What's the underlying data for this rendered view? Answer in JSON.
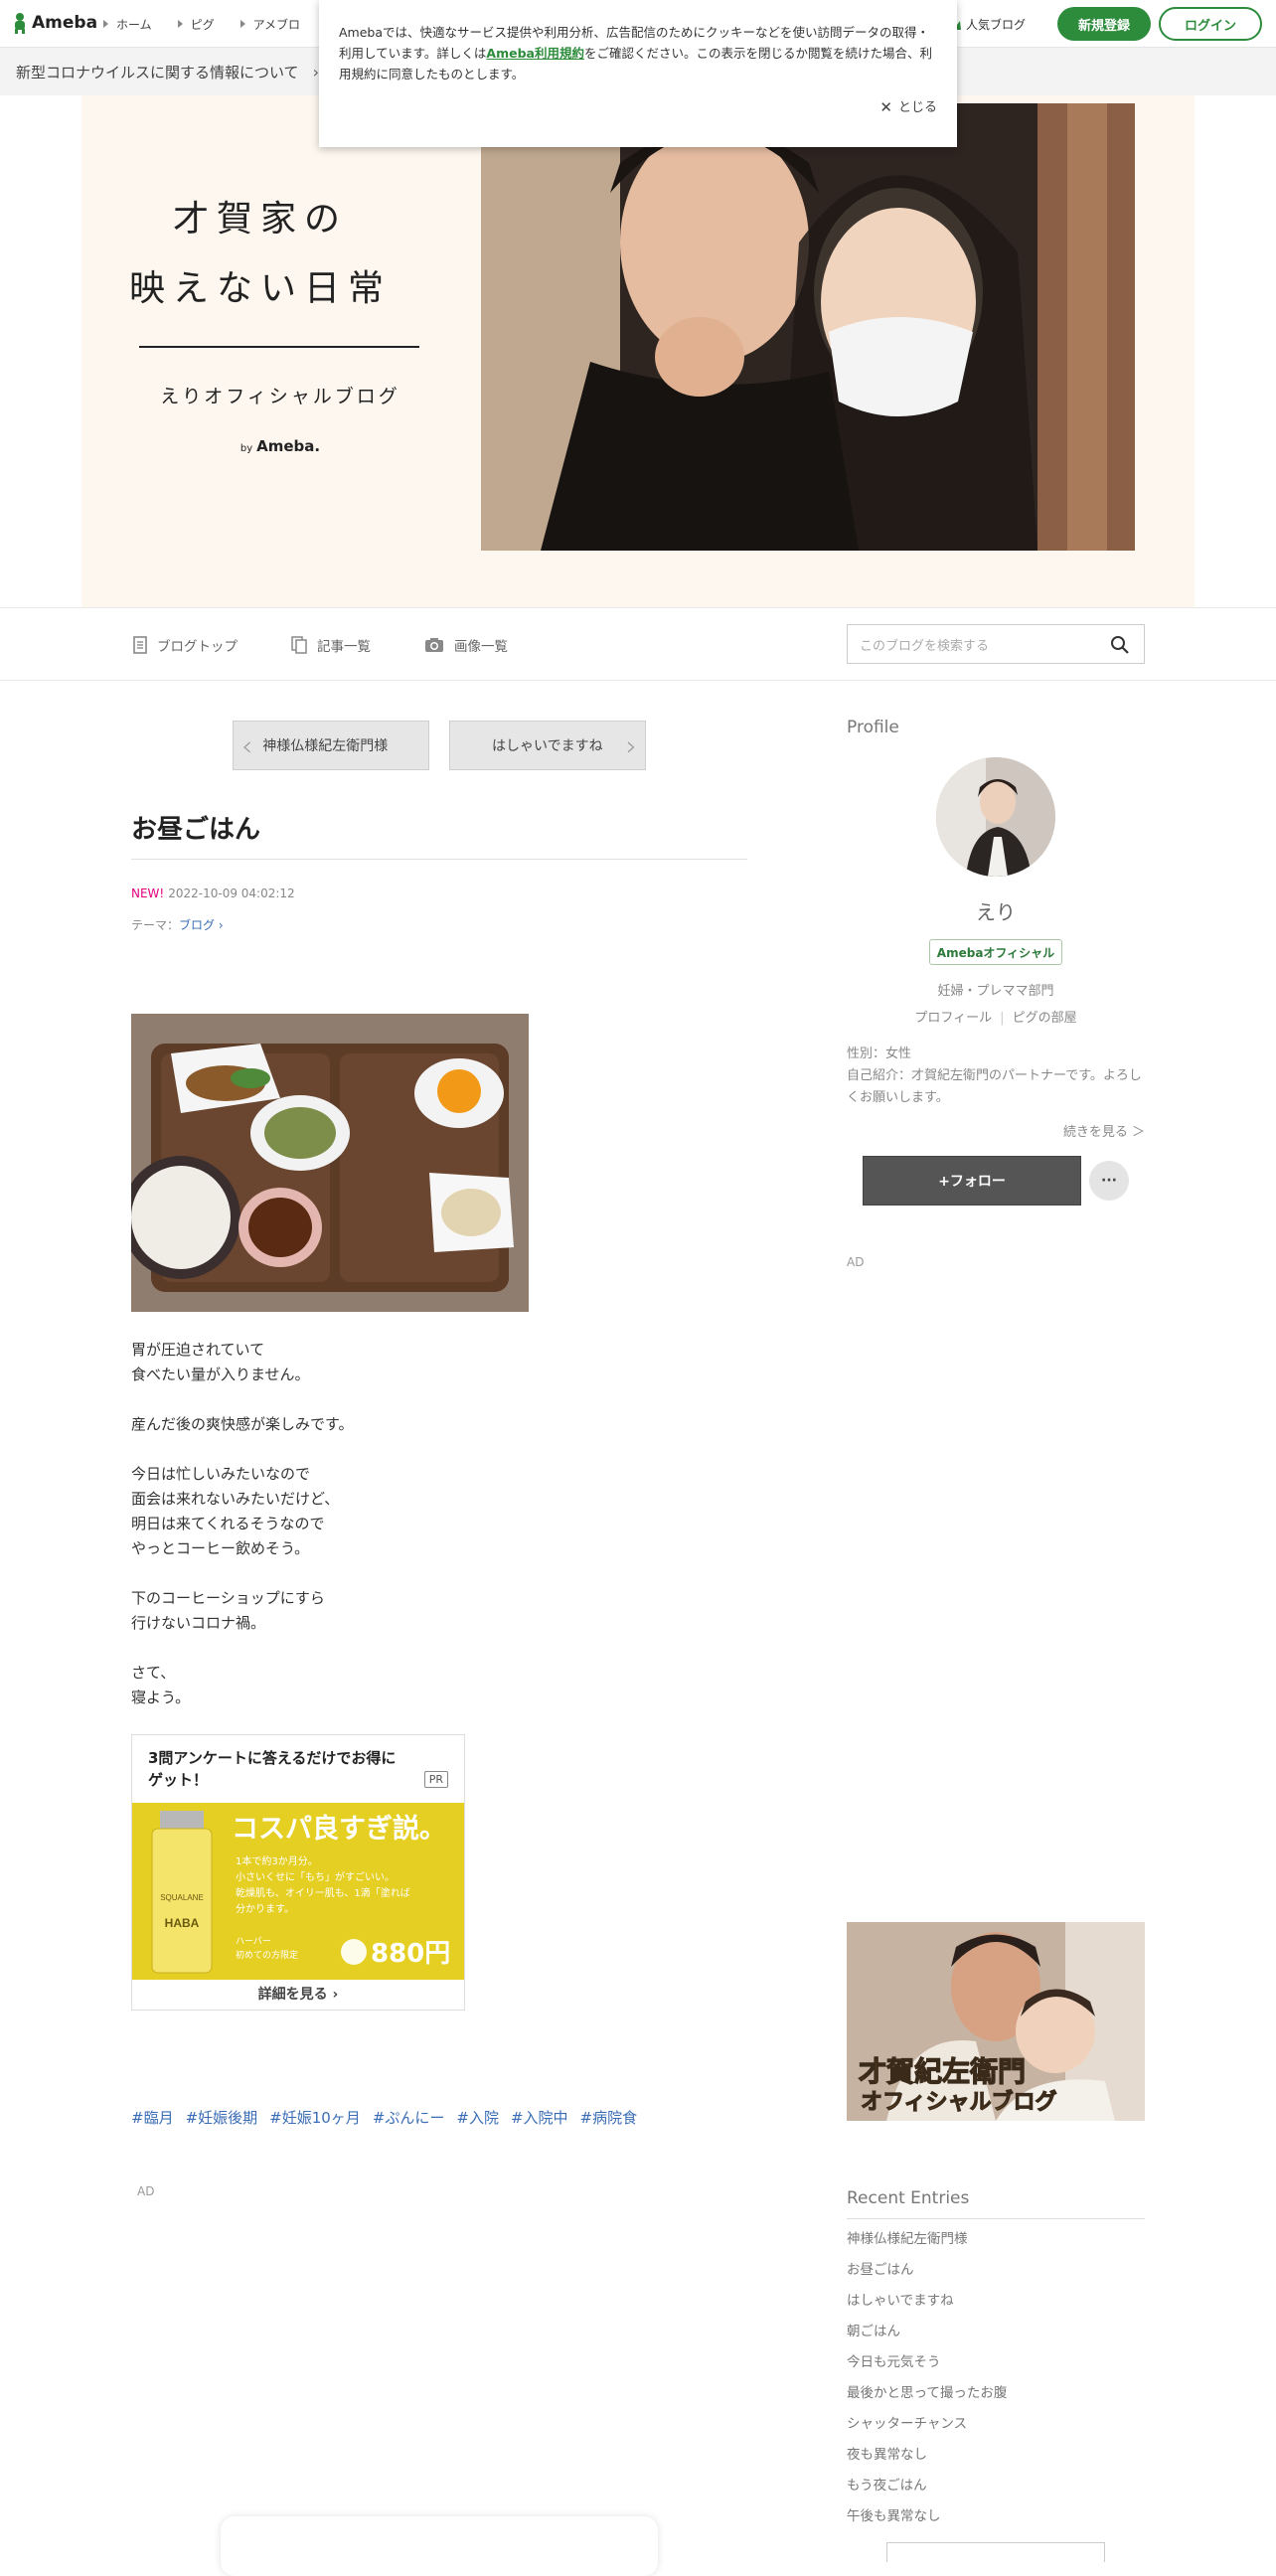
{
  "gnav": {
    "logo": "Ameba",
    "items": [
      "ホーム",
      "ピグ",
      "アメブロ"
    ],
    "popular": "人気ブログ",
    "signup": "新規登録",
    "login": "ログイン"
  },
  "covid": {
    "text": "新型コロナウイルスに関する情報について",
    "chevron": "›"
  },
  "cookie": {
    "text1": "Amebaでは、快適なサービス提供や利用分析、広告配信のためにクッキーなどを使い訪問データの取得・利用しています。詳しくは",
    "link": "Ameba利用規約",
    "text2": "をご確認ください。この表示を閉じるか閲覧を続けた場合、利用規約に同意したものとします。",
    "close": "とじる"
  },
  "banner": {
    "title_line1": "才賀家の",
    "title_line2": "映えない日常",
    "subtitle": "えりオフィシャルブログ",
    "by": "by",
    "brand": "Ameba."
  },
  "blogmenu": {
    "top": "ブログトップ",
    "entries": "記事一覧",
    "images": "画像一覧",
    "search_placeholder": "このブログを検索する"
  },
  "article": {
    "prev": "神様仏様紀左衛門様",
    "next": "はしゃいでますね",
    "title": "お昼ごはん",
    "new": "NEW!",
    "date": "2022-10-09 04:02:12",
    "theme_label": "テーマ：",
    "theme": "ブログ",
    "paragraphs": [
      "胃が圧迫されていて\n食べたい量が入りません。",
      "産んだ後の爽快感が楽しみです。",
      "今日は忙しいみたいなので\n面会は来れないみたいだけど、\n明日は来てくれるそうなので\nやっとコーヒー飲めそう。",
      "下のコーヒーショップにすら\n行けないコロナ禍。",
      "さて、\n寝よう。"
    ],
    "hashtags": [
      "#臨月",
      "#妊娠後期",
      "#妊娠10ヶ月",
      "#ぷんにー",
      "#入院",
      "#入院中",
      "#病院食"
    ],
    "ad_label": "AD"
  },
  "adcard": {
    "title": "3問アンケートに答えるだけでお得にゲット！",
    "pr": "PR",
    "headline": "コスパ良すぎ説。",
    "copy1": "1本で約3か月分。",
    "copy2": "小さいくせに「もち」がすごいい。",
    "copy3": "乾燥肌も、オイリー肌も、1滴「塗れば",
    "copy4": "分かります。",
    "brand": "HABA",
    "product": "SQUALANE",
    "price_label1": "ハーバー",
    "price_label2": "初めての方限定",
    "price": "880円",
    "more": "詳細を見る"
  },
  "sidebar": {
    "profile_h": "Profile",
    "name": "えり",
    "badge": "Amebaオフィシャル",
    "category": "妊婦・プレママ部門",
    "link_profile": "プロフィール",
    "link_room": "ピグの部屋",
    "gender": "性別：女性",
    "intro": "自己紹介：才賀紀左衛門のパートナーです。よろしくお願いします。",
    "more": "続きを見る ＞",
    "follow": "+フォロー",
    "dots": "···",
    "ad": "AD",
    "banner_line1": "才賀紀左衛門",
    "banner_line2": "オフィシャルブログ",
    "recent_h": "Recent Entries",
    "recent": [
      "神様仏様紀左衛門様",
      "お昼ごはん",
      "はしゃいでますね",
      "朝ごはん",
      "今日も元気そう",
      "最後かと思って撮ったお腹",
      "シャッターチャンス",
      "夜も異常なし",
      "もう夜ごはん",
      "午後も異常なし"
    ]
  }
}
